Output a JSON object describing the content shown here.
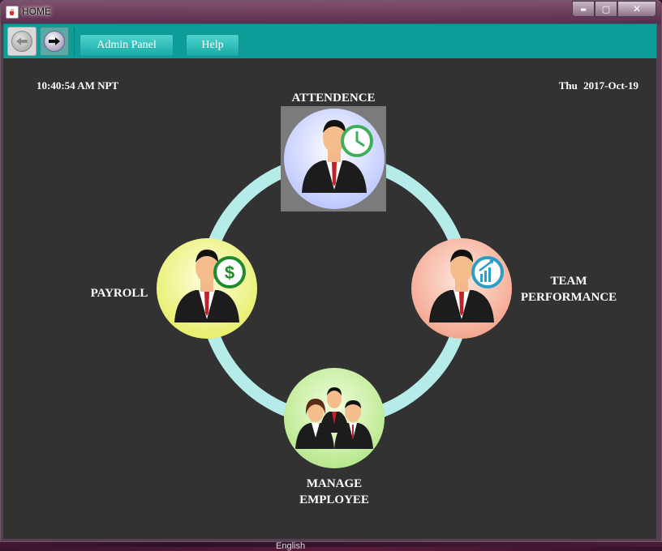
{
  "window": {
    "title": "HOME"
  },
  "window_controls": {
    "minimize": "▬",
    "maximize": "▢",
    "close": "✕"
  },
  "toolbar": {
    "admin_label": "Admin Panel",
    "help_label": "Help"
  },
  "header": {
    "time": "10:40:54 AM NPT",
    "date": "Thu  2017-Oct-19"
  },
  "modules": {
    "attendance": "ATTENDENCE",
    "payroll": "PAYROLL",
    "team_line1": "TEAM",
    "team_line2": "PERFORMANCE",
    "manage_line1": "MANAGE",
    "manage_line2": "EMPLOYEE"
  },
  "taskbar": {
    "language": "English"
  },
  "colors": {
    "toolbar": "#0d9c98",
    "ring": "#b5ebe9",
    "content": "#323232"
  }
}
